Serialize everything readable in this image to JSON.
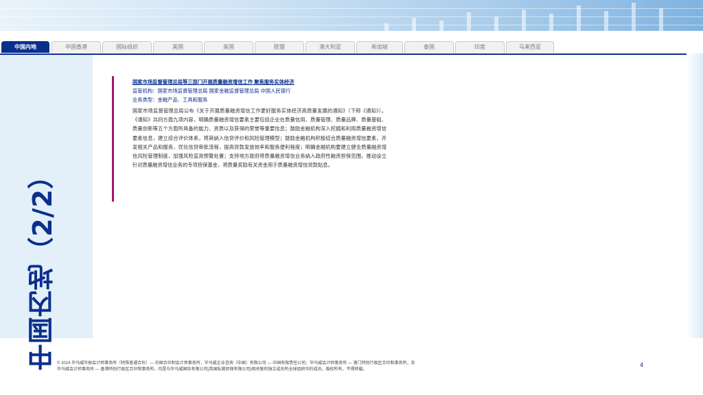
{
  "tabs": [
    {
      "label": "中国内地",
      "active": true
    },
    {
      "label": "中国香港",
      "active": false
    },
    {
      "label": "国际组织",
      "active": false
    },
    {
      "label": "美国",
      "active": false
    },
    {
      "label": "英国",
      "active": false
    },
    {
      "label": "欧盟",
      "active": false
    },
    {
      "label": "澳大利亚",
      "active": false
    },
    {
      "label": "新加坡",
      "active": false
    },
    {
      "label": "泰国",
      "active": false
    },
    {
      "label": "印度",
      "active": false
    },
    {
      "label": "马来西亚",
      "active": false
    }
  ],
  "side_title": "中国内地（2/2）",
  "article": {
    "headline": "国家市场监督管理总局等三部门开展质量融资增信工作 聚焦服务实体经济",
    "regulators": "监管机构：国家市场监督管理总局 国家金融监督管理总局 中国人民银行",
    "business_type": "业务类型：金融产品、工具和服务",
    "body": "国家市场监督管理总局公布《关于开展质量融资增信工作更好服务实体经济高质量发展的通知》（下称《通知》）。《通知》共四方面九项内容，明确质量融资增信要素主要包括企业在质量信用、质量管理、质量品牌、质量基础、质量创新等五个方面所具备的能力、资质以及获得的荣誉等重要信息；鼓励金融机构深入挖掘和利用质量融资增信要素信息，建立综合评价体系，将其纳入信贷评价和风险管理模型；鼓励金融机构积极结合质量融资增信要素，开发相关产品和服务，优化信贷审批流程，提高贷款发放效率和服务便利程度；明确金融机构要建立健全质量融资增信风险管理制度，加强风险监测预警处置；支持地方政府将质量融资增信业务纳入政府性融资担保范围，推动设立针对质量融资增信业务的专项担保基金，将质量奖励有关资金用于质量融资增信贷款贴息。"
  },
  "footer": {
    "line1": "© 2024 毕马威华振会计师事务所（特殊普通合伙）— 中国合伙制会计师事务所，毕马威企业咨询（中国）有限公司 — 中国有限责任公司，毕马威会计师事务所 — 澳门特别行政区合伙制事务所，及",
    "line2": "毕马威会计师事务所 — 香港特别行政区合伙制事务所，均是与毕马威国际有限公司(英国私营担保有限公司)相关联的独立成员所全球组织中的成员。版权所有，不得转载。"
  },
  "page_number": "4",
  "colors": {
    "brand": "#0b2f8c",
    "accent": "#a3156e",
    "panel": "#e3eff9"
  }
}
